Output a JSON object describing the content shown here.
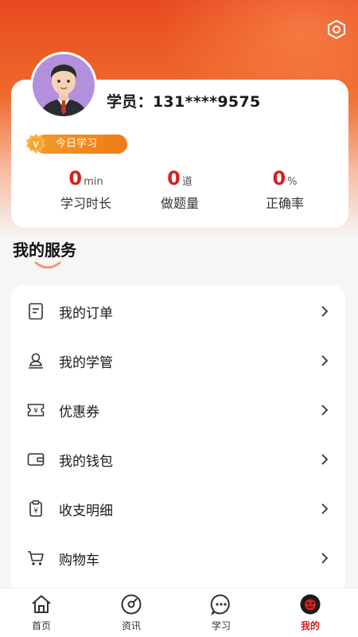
{
  "header": {
    "settings_icon": "hexagon-settings-icon"
  },
  "profile": {
    "student_label": "学员：131****9575",
    "badge_text": "今日学习",
    "badge_symbol": "V"
  },
  "stats": [
    {
      "value": "0",
      "unit": "min",
      "label": "学习时长"
    },
    {
      "value": "0",
      "unit": "道",
      "label": "做题量"
    },
    {
      "value": "0",
      "unit": "%",
      "label": "正确率"
    }
  ],
  "services": {
    "title": "我的服务",
    "items": [
      {
        "label": "我的订单",
        "icon": "order-icon"
      },
      {
        "label": "我的学管",
        "icon": "advisor-icon"
      },
      {
        "label": "优惠券",
        "icon": "coupon-icon"
      },
      {
        "label": "我的钱包",
        "icon": "wallet-icon"
      },
      {
        "label": "收支明细",
        "icon": "bill-detail-icon"
      },
      {
        "label": "购物车",
        "icon": "cart-icon"
      }
    ]
  },
  "tabbar": {
    "items": [
      {
        "label": "首页",
        "icon": "home-icon"
      },
      {
        "label": "资讯",
        "icon": "news-icon"
      },
      {
        "label": "学习",
        "icon": "study-icon"
      },
      {
        "label": "我的",
        "icon": "mine-icon",
        "active": true
      }
    ]
  },
  "colors": {
    "accent": "#d81e1e",
    "header_orange": "#e84a1f",
    "badge_orange": "#f07a16"
  }
}
